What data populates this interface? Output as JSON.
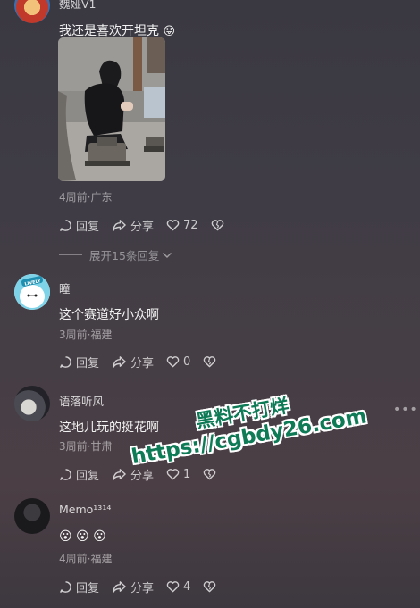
{
  "comments": [
    {
      "username": "魏娅V1",
      "text": "我还是喜欢开坦克",
      "emoji": "😝",
      "meta": "4周前·广东",
      "reply": "回复",
      "share": "分享",
      "likes": "72",
      "expand": "展开15条回复"
    },
    {
      "username": "瞳",
      "text": "这个赛道好小众啊",
      "meta": "3周前·福建",
      "reply": "回复",
      "share": "分享",
      "likes": "0"
    },
    {
      "username": "语落听风",
      "text": "这地儿玩的挺花啊",
      "meta": "3周前·甘肃",
      "reply": "回复",
      "share": "分享",
      "likes": "1"
    },
    {
      "username": "Memo¹³¹⁴",
      "text": "😮 😮 😮",
      "meta": "4周前·福建",
      "reply": "回复",
      "share": "分享",
      "likes": "4"
    }
  ],
  "avatar_badge": "LIVELY",
  "watermark": {
    "line1": "黑料不打烊",
    "line2": "https://cgbdy26.com"
  },
  "icons": {
    "reply": "reply-bubble-icon",
    "share": "share-arrow-icon",
    "like": "heart-icon",
    "dislike": "broken-heart-icon",
    "more": "more-dots-icon"
  }
}
